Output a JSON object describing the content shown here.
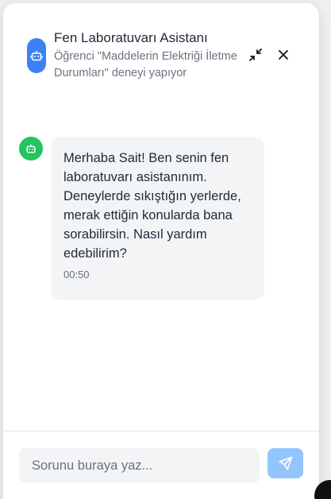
{
  "header": {
    "title": "Fen Laboratuvarı Asistanı",
    "subtitle": "Öğrenci \"Maddelerin Elektriği İletme Durumları\" deneyi yapıyor",
    "avatar_icon": "robot-icon",
    "minimize_icon": "minimize-icon",
    "close_icon": "close-icon"
  },
  "messages": [
    {
      "sender": "bot",
      "avatar_icon": "robot-icon",
      "text": "Merhaba Sait! Ben senin fen laboratuvarı asistanınım. Deneylerde sıkıştığın yerlerde, merak ettiğin konularda bana sorabilirsin. Nasıl yardım edebilirim?",
      "time": "00:50"
    }
  ],
  "composer": {
    "value": "",
    "placeholder": "Sorunu buraya yaz...",
    "send_icon": "send-icon"
  },
  "colors": {
    "header_avatar": "#3b82f6",
    "bot_avatar": "#22c55e",
    "bubble_bg": "#f3f4f6",
    "send_button": "#93c5fd"
  }
}
